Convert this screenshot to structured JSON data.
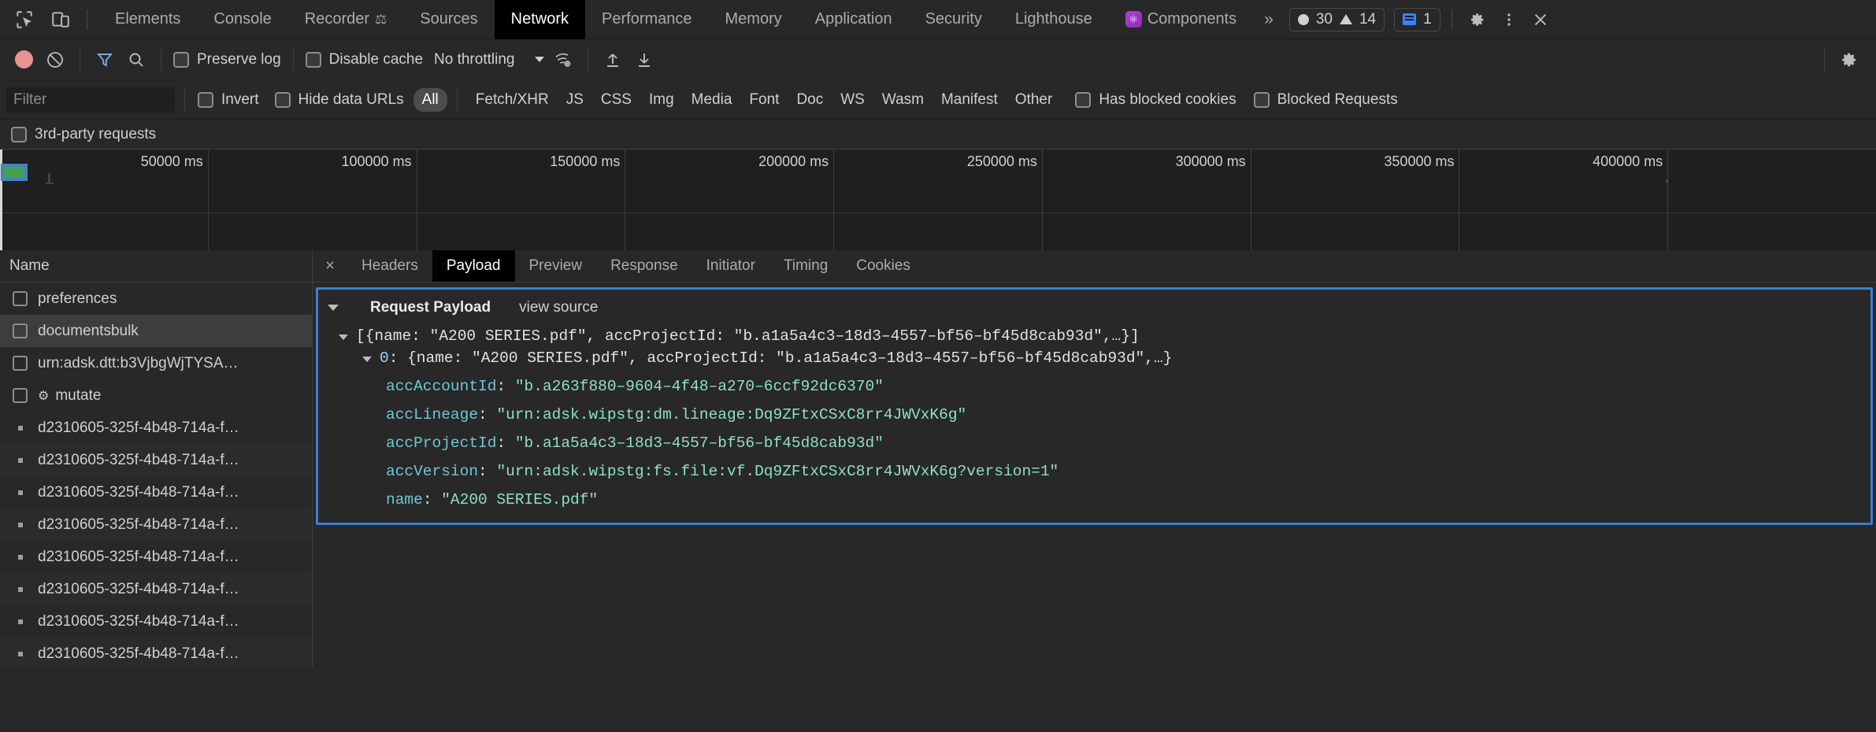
{
  "devtools": {
    "tool_icons": [
      {
        "name": "inspect-element-icon"
      },
      {
        "name": "device-toolbar-icon"
      }
    ],
    "tabs": [
      {
        "label": "Elements",
        "selected": false,
        "icon": null
      },
      {
        "label": "Console",
        "selected": false,
        "icon": null
      },
      {
        "label": "Recorder",
        "selected": false,
        "icon": "flask-icon"
      },
      {
        "label": "Sources",
        "selected": false,
        "icon": null
      },
      {
        "label": "Network",
        "selected": true,
        "icon": null
      },
      {
        "label": "Performance",
        "selected": false,
        "icon": null
      },
      {
        "label": "Memory",
        "selected": false,
        "icon": null
      },
      {
        "label": "Application",
        "selected": false,
        "icon": null
      },
      {
        "label": "Security",
        "selected": false,
        "icon": null
      },
      {
        "label": "Lighthouse",
        "selected": false,
        "icon": null
      },
      {
        "label": "Components",
        "selected": false,
        "icon": "react-icon"
      }
    ],
    "more_tabs_label": "»",
    "counters": {
      "errors": "30",
      "warnings": "14",
      "messages": "1"
    },
    "right_actions": [
      {
        "name": "settings-gear-icon"
      },
      {
        "name": "more-options-icon"
      },
      {
        "name": "close-devtools-icon"
      }
    ]
  },
  "network_toolbar": {
    "record_button": "record-button",
    "clear_button": "clear-button",
    "filter_toggle": "filter-toggle-button",
    "search_button": "search-button",
    "preserve_log": {
      "label": "Preserve log",
      "checked": false
    },
    "disable_cache": {
      "label": "Disable cache",
      "checked": false
    },
    "throttling": {
      "value": "No throttling"
    },
    "network_conditions": "network-conditions-icon",
    "import_har": "import-har-icon",
    "export_har": "export-har-icon",
    "settings": "network-settings-icon"
  },
  "filter_bar": {
    "filter_placeholder": "Filter",
    "filter_value": "",
    "invert": {
      "label": "Invert",
      "checked": false
    },
    "hide_data_urls": {
      "label": "Hide data URLs",
      "checked": false
    },
    "types": [
      {
        "label": "All",
        "active": true
      },
      {
        "label": "Fetch/XHR",
        "active": false
      },
      {
        "label": "JS",
        "active": false
      },
      {
        "label": "CSS",
        "active": false
      },
      {
        "label": "Img",
        "active": false
      },
      {
        "label": "Media",
        "active": false
      },
      {
        "label": "Font",
        "active": false
      },
      {
        "label": "Doc",
        "active": false
      },
      {
        "label": "WS",
        "active": false
      },
      {
        "label": "Wasm",
        "active": false
      },
      {
        "label": "Manifest",
        "active": false
      },
      {
        "label": "Other",
        "active": false
      }
    ],
    "has_blocked_cookies": {
      "label": "Has blocked cookies",
      "checked": false
    },
    "blocked_requests": {
      "label": "Blocked Requests",
      "checked": false
    },
    "third_party_requests": {
      "label": "3rd-party requests",
      "checked": false
    }
  },
  "overview": {
    "ticks": [
      "50000 ms",
      "100000 ms",
      "150000 ms",
      "200000 ms",
      "250000 ms",
      "300000 ms",
      "350000 ms",
      "400000 ms"
    ],
    "bar_color": "#41a350",
    "bar_outline_color": "#4a7fc1"
  },
  "request_list": {
    "column_header": "Name",
    "rows": [
      {
        "name": "preferences",
        "type": "checkbox",
        "selected": false
      },
      {
        "name": "documentsbulk",
        "type": "checkbox",
        "selected": true
      },
      {
        "name": "urn:adsk.dtt:b3VjbgWjTYSA…",
        "type": "checkbox",
        "selected": false
      },
      {
        "name": "mutate",
        "type": "checkbox",
        "selected": false,
        "icon": "gear-icon"
      },
      {
        "name": "d2310605-325f-4b48-714a-f…",
        "type": "dot",
        "selected": false
      },
      {
        "name": "d2310605-325f-4b48-714a-f…",
        "type": "dot",
        "selected": false
      },
      {
        "name": "d2310605-325f-4b48-714a-f…",
        "type": "dot",
        "selected": false
      },
      {
        "name": "d2310605-325f-4b48-714a-f…",
        "type": "dot",
        "selected": false
      },
      {
        "name": "d2310605-325f-4b48-714a-f…",
        "type": "dot",
        "selected": false
      },
      {
        "name": "d2310605-325f-4b48-714a-f…",
        "type": "dot",
        "selected": false
      },
      {
        "name": "d2310605-325f-4b48-714a-f…",
        "type": "dot",
        "selected": false
      },
      {
        "name": "d2310605-325f-4b48-714a-f…",
        "type": "dot",
        "selected": false
      }
    ]
  },
  "detail_panel": {
    "close_label": "×",
    "tabs": [
      {
        "label": "Headers",
        "selected": false
      },
      {
        "label": "Payload",
        "selected": true
      },
      {
        "label": "Preview",
        "selected": false
      },
      {
        "label": "Response",
        "selected": false
      },
      {
        "label": "Initiator",
        "selected": false
      },
      {
        "label": "Timing",
        "selected": false
      },
      {
        "label": "Cookies",
        "selected": false
      }
    ],
    "payload": {
      "section_title": "Request Payload",
      "view_source_label": "view source",
      "root_line": "[{name: \"A200 SERIES.pdf\", accProjectId: \"b.a1a5a4c3–18d3–4557–bf56–bf45d8cab93d\",…}]",
      "item_index": "0",
      "item_line": ": {name: \"A200 SERIES.pdf\", accProjectId: \"b.a1a5a4c3–18d3–4557–bf56–bf45d8cab93d\",…}",
      "properties": [
        {
          "key": "accAccountId",
          "value": "\"b.a263f880–9604–4f48–a270–6ccf92dc6370\""
        },
        {
          "key": "accLineage",
          "value": "\"urn:adsk.wipstg:dm.lineage:Dq9ZFtxCSxC8rr4JWVxK6g\""
        },
        {
          "key": "accProjectId",
          "value": "\"b.a1a5a4c3–18d3–4557–bf56–bf45d8cab93d\""
        },
        {
          "key": "accVersion",
          "value": "\"urn:adsk.wipstg:fs.file:vf.Dq9ZFtxCSxC8rr4JWVxK6g?version=1\""
        },
        {
          "key": "name",
          "value": "\"A200 SERIES.pdf\""
        }
      ]
    }
  }
}
